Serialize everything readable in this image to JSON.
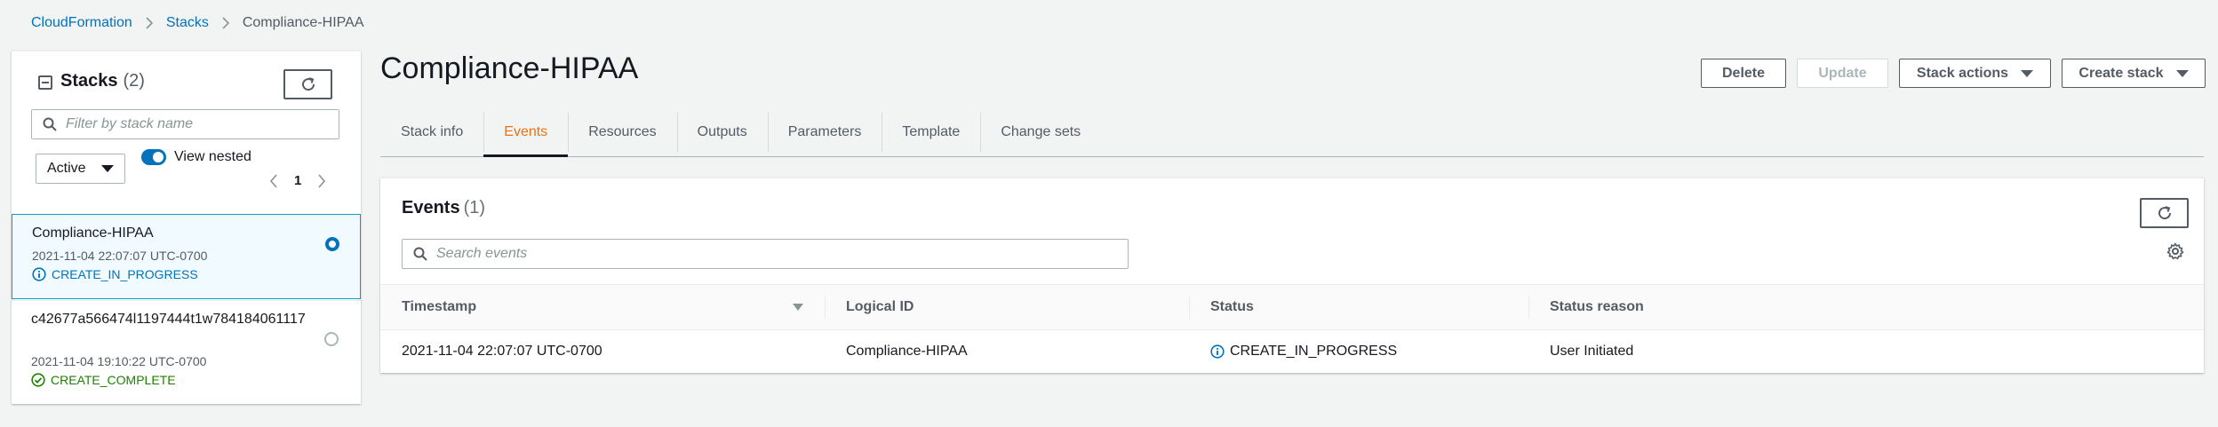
{
  "breadcrumb": {
    "items": [
      "CloudFormation",
      "Stacks"
    ],
    "current": "Compliance-HIPAA"
  },
  "stacks_panel": {
    "title": "Stacks",
    "count": "(2)",
    "search_placeholder": "Filter by stack name",
    "filter_value": "Active",
    "view_nested_label": "View nested",
    "view_nested_on": true,
    "page": "1",
    "stacks": [
      {
        "name": "Compliance-HIPAA",
        "time": "2021-11-04 22:07:07 UTC-0700",
        "status": "CREATE_IN_PROGRESS",
        "status_icon": "info-icon",
        "selected": true
      },
      {
        "name": "c42677a566474l1197444t1w784184061117",
        "time": "2021-11-04 19:10:22 UTC-0700",
        "status": "CREATE_COMPLETE",
        "status_icon": "check-circle-icon",
        "selected": false
      }
    ]
  },
  "main": {
    "title": "Compliance-HIPAA",
    "buttons": {
      "delete": "Delete",
      "update": "Update",
      "stack_actions": "Stack actions",
      "create_stack": "Create stack"
    },
    "tabs": [
      "Stack info",
      "Events",
      "Resources",
      "Outputs",
      "Parameters",
      "Template",
      "Change sets"
    ],
    "active_tab": "Events"
  },
  "events": {
    "title": "Events",
    "count": "(1)",
    "search_placeholder": "Search events",
    "columns": [
      "Timestamp",
      "Logical ID",
      "Status",
      "Status reason"
    ],
    "rows": [
      {
        "timestamp": "2021-11-04 22:07:07 UTC-0700",
        "logical_id": "Compliance-HIPAA",
        "status": "CREATE_IN_PROGRESS",
        "status_reason": "User Initiated"
      }
    ]
  },
  "colors": {
    "link": "#0073bb",
    "accent_tab": "#ec7211",
    "success": "#1d8102",
    "selected_bg": "#f1faff",
    "selected_border": "#00a1c9"
  }
}
